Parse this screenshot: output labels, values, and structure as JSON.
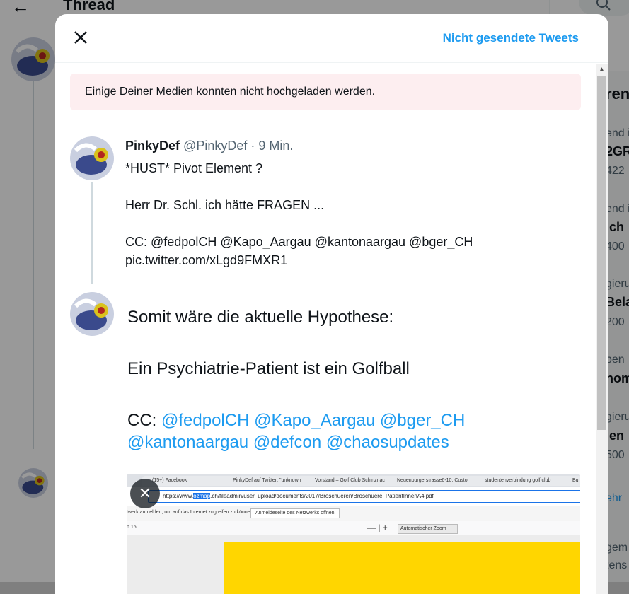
{
  "background": {
    "header_title": "Thread",
    "right_column": {
      "heading": "ren",
      "items": [
        {
          "category": "end i",
          "title": "2GR",
          "count": "422"
        },
        {
          "category": "end i",
          "title": "ich",
          "count": "400"
        },
        {
          "category": "gieru",
          "title": "Bela",
          "count": "200"
        },
        {
          "category": "ben",
          "title": "hom",
          "count": ""
        },
        {
          "category": "gieru",
          "title": "len",
          "count": "500"
        }
      ],
      "more_link": "ehr",
      "footer_1": "gem",
      "footer_2": "tens"
    }
  },
  "modal": {
    "unsent_link": "Nicht gesendete Tweets",
    "error_message": "Einige Deiner Medien konnten nicht hochgeladen werden.",
    "tweet1": {
      "display_name": "PinkyDef",
      "meta": "@PinkyDef · 9 Min.",
      "line1": "*HUST* Pivot Element ?",
      "line2": "Herr Dr. Schl. ich hätte FRAGEN ...",
      "line3": "CC: @fedpolCH @Kapo_Aargau @kantonaargau @bger_CH",
      "line4": "pic.twitter.com/xLgd9FMXR1"
    },
    "draft": {
      "line1": "Somit wäre die aktuelle Hypothese:",
      "line2": "Ein Psychiatrie-Patient ist ein Golfball",
      "cc_prefix": "CC: ",
      "mentions_row1": "@fedpolCH @Kapo_Aargau @bger_CH",
      "mentions_row2": "@kantonaargau @defcon @chaosupdates"
    },
    "media_screenshot": {
      "tabs": [
        "(15+) Facebook",
        "PinkyDef auf Twitter: \"unknown",
        "Vorstand – Golf Club Schinznac",
        "Neuenburgerstrasse6-10: Custo",
        "studentenverbindung golf club",
        "Bu"
      ],
      "url_prefix": "https://www.",
      "url_highlight": "ozmap",
      "url_rest": ".ch/fileadmin/user_upload/documents/2017/Broschueren/Broschuere_PatientInnenA4.pdf",
      "notice": "twerk anmelden, um auf das Internet zugreifen zu können.",
      "notice_button": "Anmeldeseite des Netzwerks öffnen",
      "page_of": "n 16",
      "zoom": "Automatischer Zoom",
      "colors": {
        "page": "#ffd600"
      }
    }
  },
  "colors": {
    "accent": "#1d9bf0",
    "error_bg": "#fdeef0"
  }
}
